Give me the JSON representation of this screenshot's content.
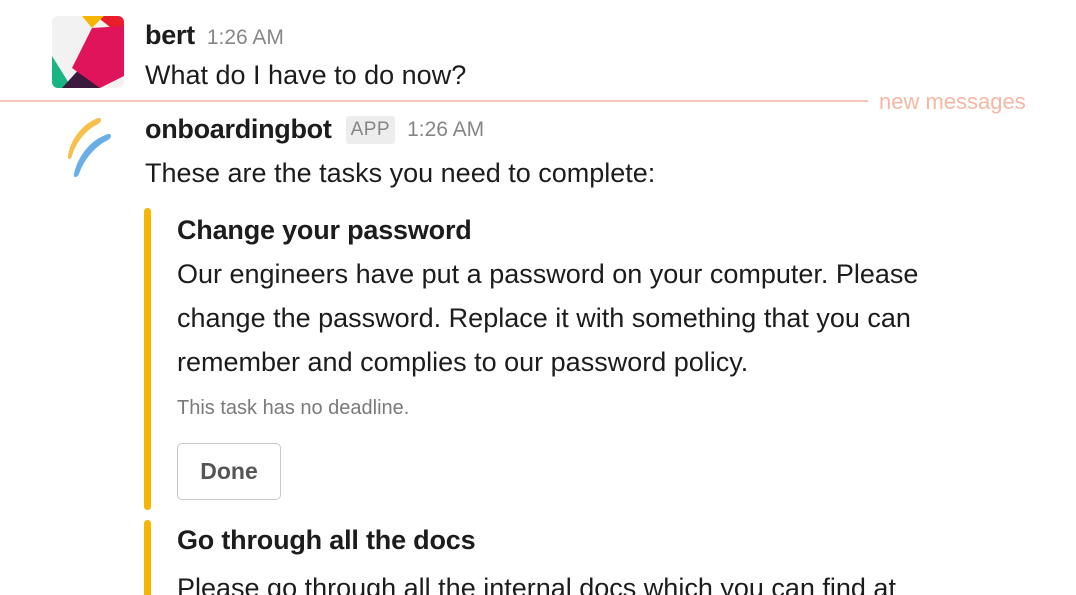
{
  "messages": [
    {
      "author": "bert",
      "time": "1:26 AM",
      "text": "What do I have to do now?"
    },
    {
      "author": "onboardingbot",
      "badge": "APP",
      "time": "1:26 AM",
      "text": "These are the tasks you need to complete:"
    }
  ],
  "divider": {
    "label": "new messages",
    "color": "#f7c5b6"
  },
  "tasks": [
    {
      "title": "Change your password",
      "body": "Our engineers have put a password on your computer. Please change the password. Replace it with something that you can remember and complies to our password policy.",
      "footer": "This task has no deadline.",
      "button_label": "Done",
      "accent_color": "#f5b500"
    },
    {
      "title": "Go through all the docs",
      "body": "Please go through all the internal docs which you can find at",
      "accent_color": "#f5b500"
    }
  ],
  "icons": {
    "bert_avatar": "slack-logo-avatar",
    "bot_avatar": "brush-strokes-logo-avatar"
  }
}
